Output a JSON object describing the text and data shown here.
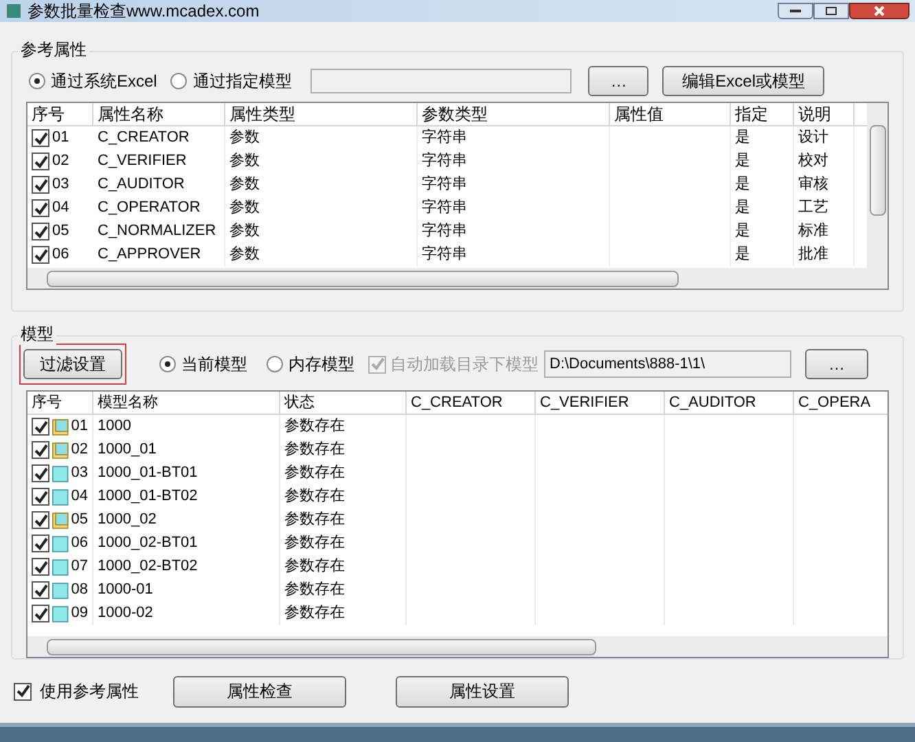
{
  "window": {
    "title": "参数批量检查www.mcadex.com"
  },
  "reference": {
    "title": "参考属性",
    "sources": [
      {
        "label": "通过系统Excel",
        "selected": true
      },
      {
        "label": "通过指定模型",
        "selected": false
      }
    ],
    "browse_button": "…",
    "edit_button": "编辑Excel或模型",
    "columns": [
      "序号",
      "属性名称",
      "属性类型",
      "参数类型",
      "属性值",
      "指定",
      "说明"
    ],
    "rows": [
      {
        "checked": true,
        "cells": [
          "01",
          "C_CREATOR",
          "参数",
          "字符串",
          "",
          "是",
          "设计"
        ]
      },
      {
        "checked": true,
        "cells": [
          "02",
          "C_VERIFIER",
          "参数",
          "字符串",
          "",
          "是",
          "校对"
        ]
      },
      {
        "checked": true,
        "cells": [
          "03",
          "C_AUDITOR",
          "参数",
          "字符串",
          "",
          "是",
          "审核"
        ]
      },
      {
        "checked": true,
        "cells": [
          "04",
          "C_OPERATOR",
          "参数",
          "字符串",
          "",
          "是",
          "工艺"
        ]
      },
      {
        "checked": true,
        "cells": [
          "05",
          "C_NORMALIZER",
          "参数",
          "字符串",
          "",
          "是",
          "标准"
        ]
      },
      {
        "checked": true,
        "cells": [
          "06",
          "C_APPROVER",
          "参数",
          "字符串",
          "",
          "是",
          "批准"
        ]
      }
    ]
  },
  "model": {
    "title": "模型",
    "filter_button": {
      "label": "过滤设置",
      "highlighted": true
    },
    "sources": [
      {
        "label": "当前模型",
        "selected": true
      },
      {
        "label": "内存模型",
        "selected": false
      }
    ],
    "auto_load": {
      "label": "自动加载目录下模型",
      "checked": true,
      "disabled": true
    },
    "path": "D:\\Documents\\888-1\\1\\",
    "browse_button": "…",
    "columns": [
      "序号",
      "模型名称",
      "状态",
      "C_CREATOR",
      "C_VERIFIER",
      "C_AUDITOR",
      "C_OPERA"
    ],
    "rows": [
      {
        "checked": true,
        "kind": "assembly",
        "cells": [
          "01",
          "1000",
          "参数存在"
        ]
      },
      {
        "checked": true,
        "kind": "assembly",
        "cells": [
          "02",
          "1000_01",
          "参数存在"
        ]
      },
      {
        "checked": true,
        "kind": "part",
        "cells": [
          "03",
          "1000_01-BT01",
          "参数存在"
        ]
      },
      {
        "checked": true,
        "kind": "part",
        "cells": [
          "04",
          "1000_01-BT02",
          "参数存在"
        ]
      },
      {
        "checked": true,
        "kind": "assembly",
        "cells": [
          "05",
          "1000_02",
          "参数存在"
        ]
      },
      {
        "checked": true,
        "kind": "part",
        "cells": [
          "06",
          "1000_02-BT01",
          "参数存在"
        ]
      },
      {
        "checked": true,
        "kind": "part",
        "cells": [
          "07",
          "1000_02-BT02",
          "参数存在"
        ]
      },
      {
        "checked": true,
        "kind": "part",
        "cells": [
          "08",
          "1000-01",
          "参数存在"
        ]
      },
      {
        "checked": true,
        "kind": "part",
        "cells": [
          "09",
          "1000-02",
          "参数存在"
        ]
      }
    ]
  },
  "footer": {
    "use_reference": {
      "label": "使用参考属性",
      "checked": true
    },
    "buttons": [
      "属性检查",
      "属性设置"
    ]
  }
}
